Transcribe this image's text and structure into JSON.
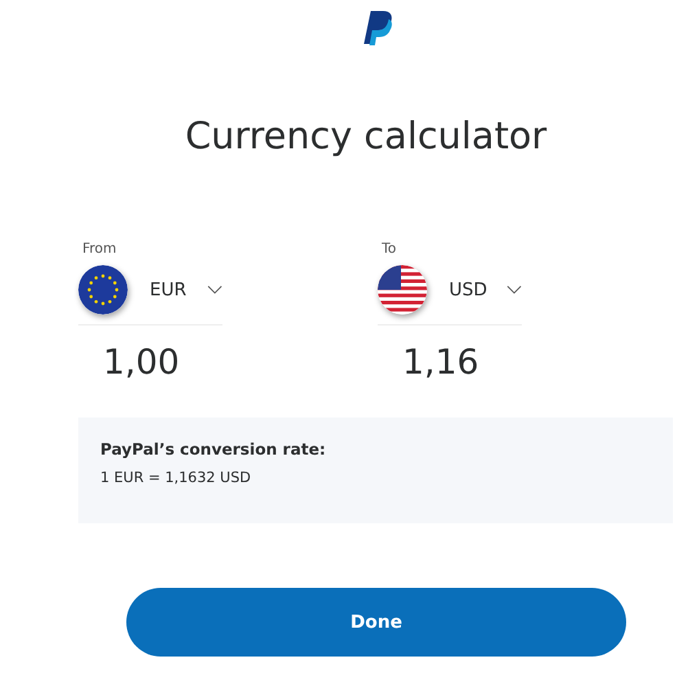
{
  "title": "Currency calculator",
  "converters": [
    {
      "label": "From",
      "kind": "eu",
      "currency": "EUR",
      "amount": "1,00"
    },
    {
      "label": "To",
      "kind": "us",
      "currency": "USD",
      "amount": "1,16"
    }
  ],
  "rate": {
    "heading": "PayPal’s conversion rate:",
    "value": "1 EUR = 1,1632 USD"
  },
  "done_button": "Done"
}
